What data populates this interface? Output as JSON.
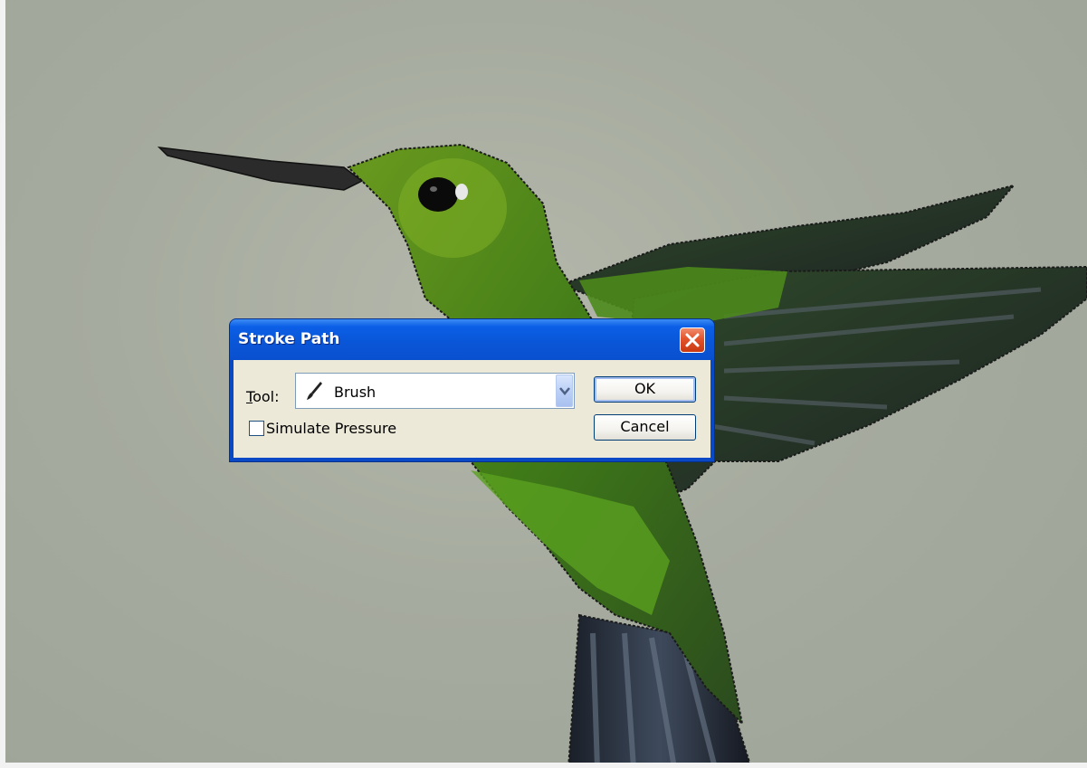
{
  "dialog": {
    "title": "Stroke Path",
    "tool_label_mnemonic": "T",
    "tool_label_rest": "ool:",
    "tool_value": "Brush",
    "tool_icon": "brush-icon",
    "simulate_pressure_label": "Simulate Pressure",
    "simulate_pressure_checked": false,
    "ok_label": "OK",
    "cancel_label": "Cancel",
    "close_icon": "close-icon"
  },
  "colors": {
    "title_bar": "#0a56d8",
    "close_button": "#e2532b",
    "dialog_body": "#ece9d8"
  }
}
